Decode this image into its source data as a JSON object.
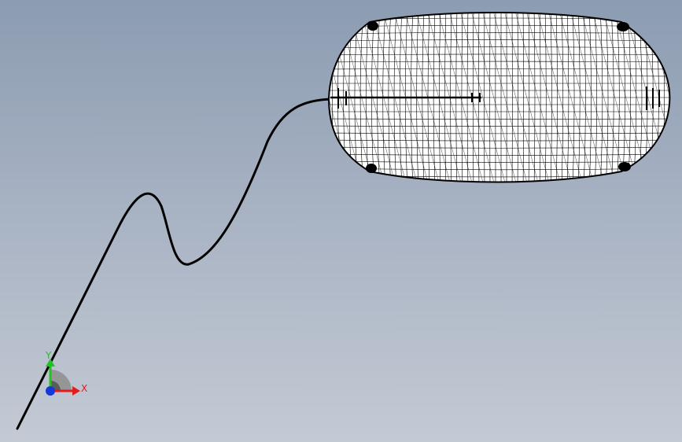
{
  "viewport": {
    "background_top": "#8c9cb1",
    "background_bottom": "#c4cad4"
  },
  "model": {
    "curve_color": "#000000",
    "mesh_fill": "#ffffff",
    "mesh_line": "#000000"
  },
  "triad": {
    "x_label": "X",
    "y_label": "Y",
    "x_color": "#e31b1b",
    "y_color": "#22c122",
    "z_color": "#1638d8"
  }
}
